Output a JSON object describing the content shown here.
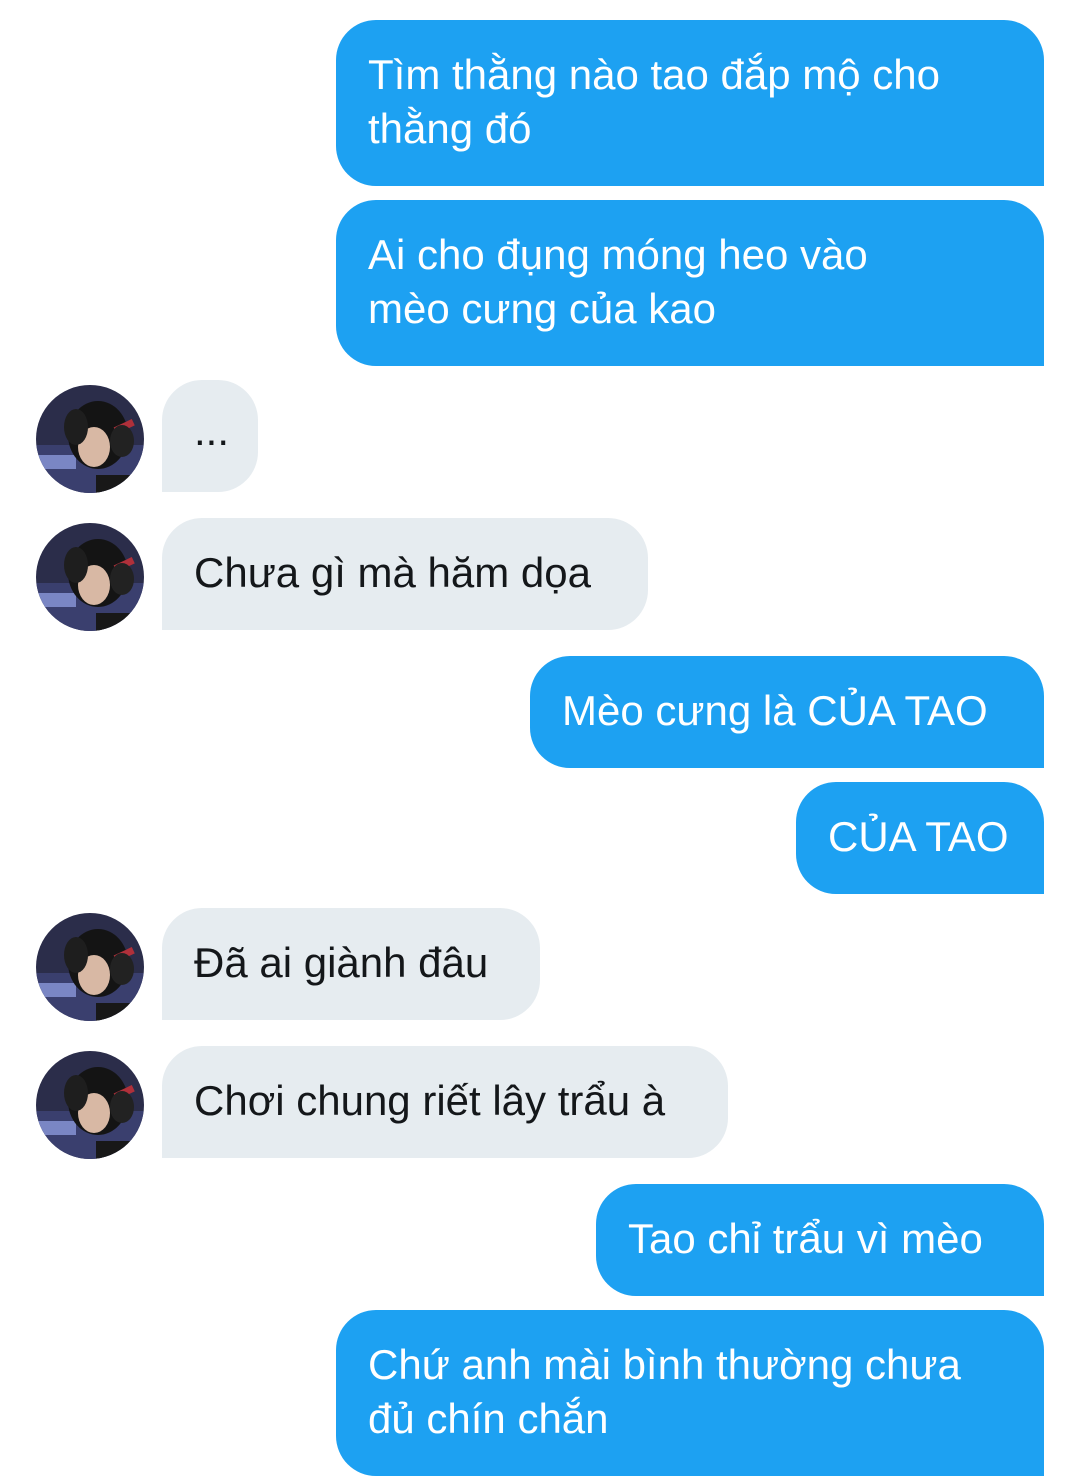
{
  "conversation": {
    "messages": [
      {
        "sender": "me",
        "lines": [
          "Tìm thằng nào tao đắp mộ cho",
          "thằng đó"
        ]
      },
      {
        "sender": "me",
        "lines": [
          "Ai cho đụng móng heo vào",
          "mèo cưng của kao"
        ]
      },
      {
        "sender": "them",
        "lines": [
          "..."
        ]
      },
      {
        "sender": "them",
        "lines": [
          "Chưa gì mà hăm dọa"
        ]
      },
      {
        "sender": "me",
        "lines": [
          "Mèo cưng là CỦA TAO"
        ]
      },
      {
        "sender": "me",
        "lines": [
          "CỦA TAO"
        ]
      },
      {
        "sender": "them",
        "lines": [
          "Đã ai giành đâu"
        ]
      },
      {
        "sender": "them",
        "lines": [
          "Chơi chung riết lây trẩu à"
        ]
      },
      {
        "sender": "me",
        "lines": [
          "Tao chỉ trẩu vì mèo"
        ]
      },
      {
        "sender": "me",
        "lines": [
          "Chứ anh mài bình thường chưa",
          "đủ chín chắn"
        ]
      }
    ]
  },
  "colors": {
    "sent_bubble": "#1da1f2",
    "received_bubble": "#e6ecf0",
    "sent_text": "#ffffff",
    "received_text": "#14171a"
  },
  "icons": {
    "avatar": "contact-avatar-photo-icon"
  }
}
